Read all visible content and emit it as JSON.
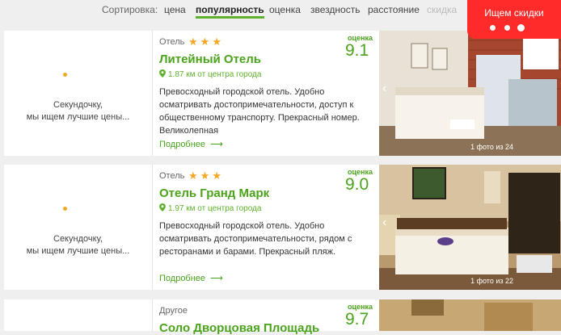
{
  "sort": {
    "label": "Сортировка:",
    "options": [
      {
        "label": "цена"
      },
      {
        "label": "популярность"
      },
      {
        "label": "оценка"
      },
      {
        "label": "звездность"
      },
      {
        "label": "расстояние"
      },
      {
        "label": "скидка"
      }
    ]
  },
  "discount_badge": {
    "label": "Ищем скидки"
  },
  "hotels": [
    {
      "loading_text": "Секундочку,\nмы ищем лучшие цены...",
      "type": "Отель",
      "stars": 3,
      "name": "Литейный Отель",
      "distance": "1.87 км от центра города",
      "description": "Превосходный городской отель. Удобно осматривать достопримечательности, доступ к общественному транспорту. Прекрасный номер. Великолепная",
      "more_label": "Подробнее",
      "score_label": "оценка",
      "score": "9.1",
      "photo_count": "1 фото из 24"
    },
    {
      "loading_text": "Секундочку,\nмы ищем лучшие цены...",
      "type": "Отель",
      "stars": 3,
      "name": "Отель Гранд Марк",
      "distance": "1.97 км от центра города",
      "description": "Превосходный городской отель. Удобно осматривать достопримечательности, рядом с ресторанами и барами. Прекрасный пляж.",
      "more_label": "Подробнее",
      "score_label": "оценка",
      "score": "9.0",
      "photo_count": "1 фото из 22"
    },
    {
      "type": "Другое",
      "name": "Соло Дворцовая Площадь",
      "score_label": "оценка",
      "score": "9.7"
    }
  ],
  "icons": {
    "star": "star-icon",
    "pin": "map-pin-icon",
    "arrow": "arrow-right-icon",
    "chevron": "chevron-left-icon"
  },
  "colors": {
    "accent": "#4aa31b",
    "badge": "#ff2a2a",
    "star": "#f5a623"
  }
}
